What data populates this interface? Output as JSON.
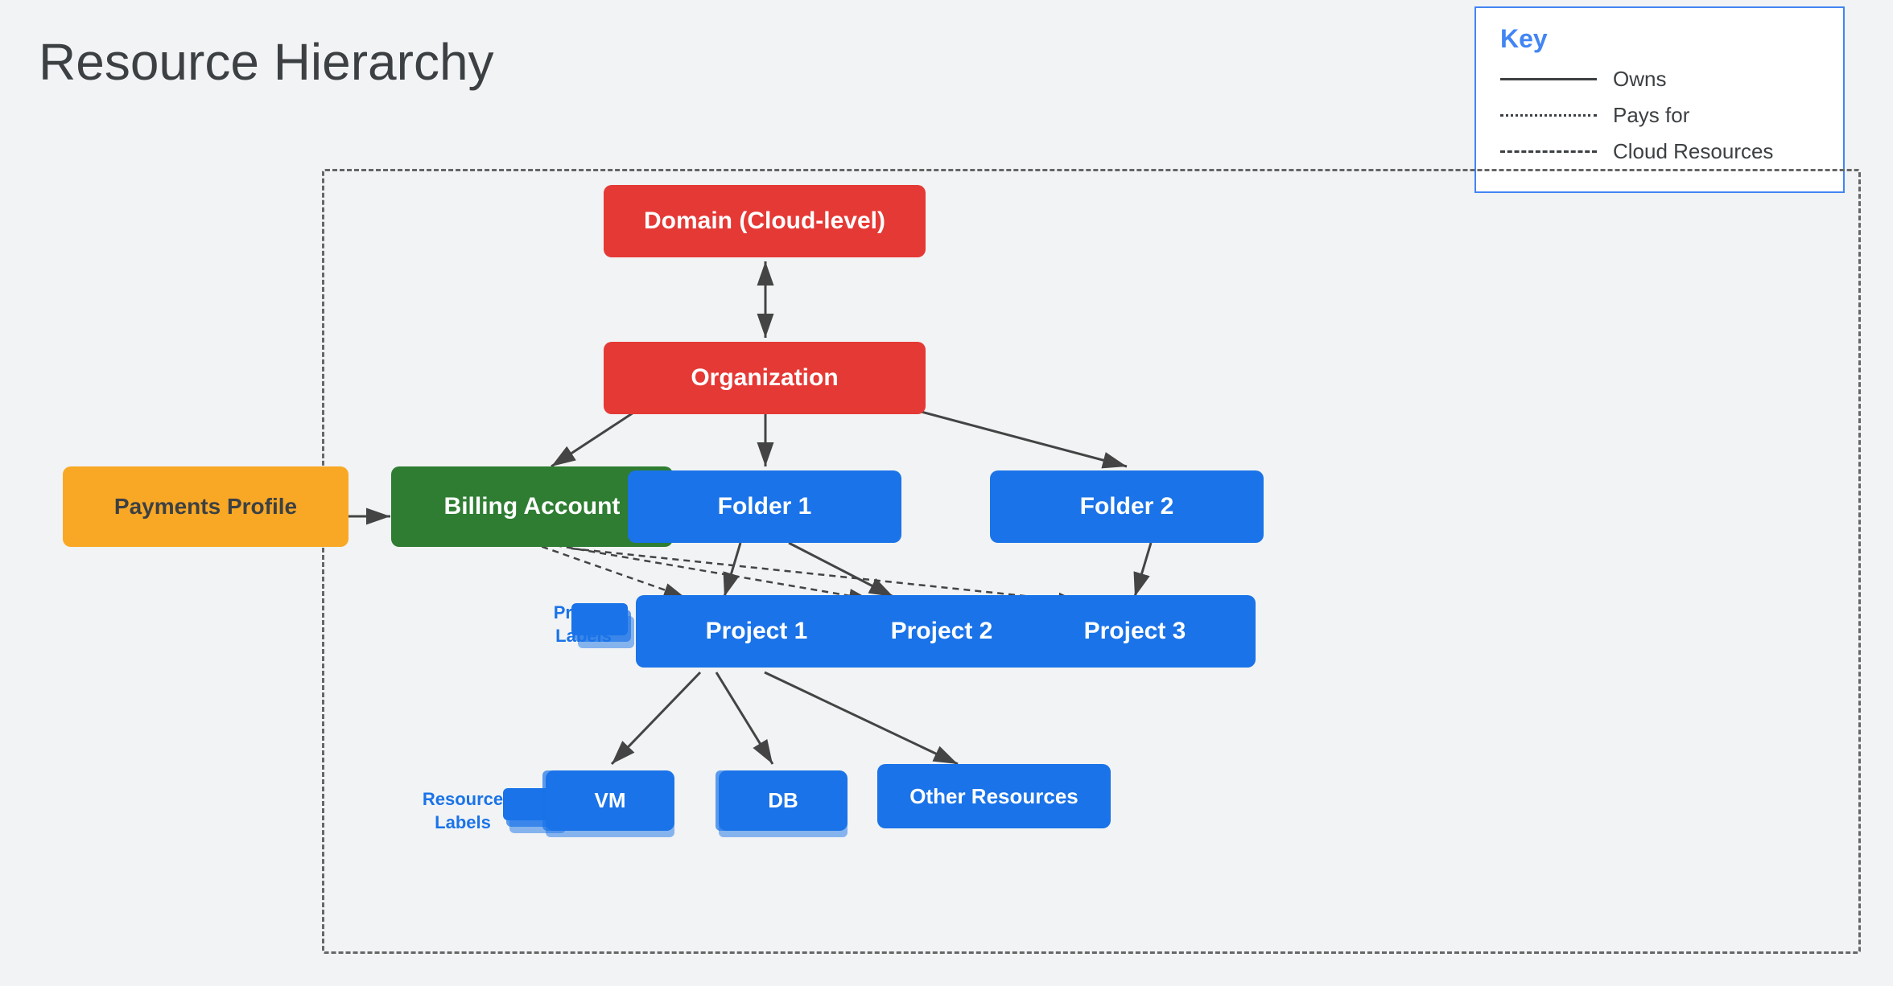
{
  "title": "Resource Hierarchy",
  "key": {
    "title": "Key",
    "items": [
      {
        "line": "solid",
        "label": "Owns"
      },
      {
        "line": "dotted",
        "label": "Pays for"
      },
      {
        "line": "dashed",
        "label": "Cloud Resources"
      }
    ]
  },
  "nodes": {
    "domain": "Domain (Cloud-level)",
    "organization": "Organization",
    "billing_account": "Billing Account",
    "payments_profile": "Payments Profile",
    "folder1": "Folder 1",
    "folder2": "Folder 2",
    "project1": "Project 1",
    "project2": "Project 2",
    "project3": "Project 3",
    "vm": "VM",
    "db": "DB",
    "other_resources": "Other Resources"
  },
  "labels": {
    "project_labels": "Project\nLabels",
    "resource_labels": "Resource\nLabels"
  }
}
